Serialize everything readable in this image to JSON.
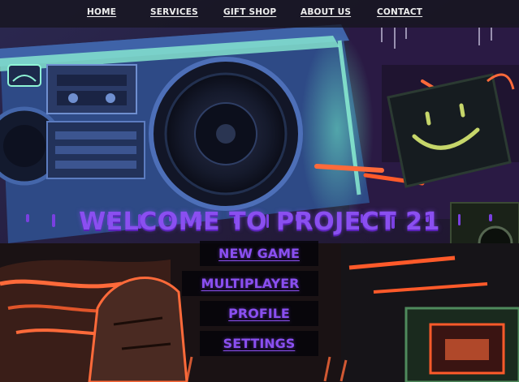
{
  "nav": {
    "items": [
      {
        "label": "HOME"
      },
      {
        "label": "SERVICES"
      },
      {
        "label": "GIFT SHOP"
      },
      {
        "label": "ABOUT US"
      },
      {
        "label": "CONTACT"
      }
    ]
  },
  "hero": {
    "headline": "WELCOME TO PROJECT 21"
  },
  "menu": {
    "items": [
      {
        "label": "NEW GAME"
      },
      {
        "label": "MULTIPLAYER"
      },
      {
        "label": "PROFILE"
      },
      {
        "label": "SETTINGS"
      }
    ]
  },
  "colors": {
    "accent": "#8a4ff0",
    "nav_bar": "#16141e",
    "button_bg": "#06050a",
    "nav_text": "#eeeeee"
  }
}
